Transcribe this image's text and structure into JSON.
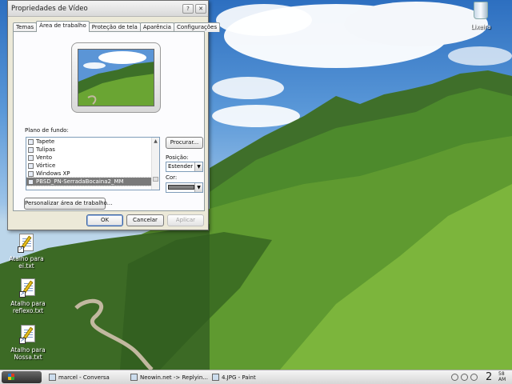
{
  "dialog": {
    "title": "Propriedades de Vídeo",
    "tabs": [
      "Temas",
      "Área de trabalho",
      "Proteção de tela",
      "Aparência",
      "Configurações"
    ],
    "active_tab": 1,
    "background_label": "Plano de fundo:",
    "background_items": [
      "Tapete",
      "Tulipas",
      "Vento",
      "Vórtice",
      "Windows XP",
      "PBSD_PN-SerradaBocaina2_MM"
    ],
    "selected_item": 5,
    "browse_button": "Procurar...",
    "position_label": "Posição:",
    "position_value": "Estender",
    "color_label": "Cor:",
    "customize_button": "Personalizar área de trabalho...",
    "ok_button": "OK",
    "cancel_button": "Cancelar",
    "apply_button": "Aplicar"
  },
  "desktop": {
    "icons": [
      {
        "label": "Lixeira"
      },
      {
        "label": "Atalho para ei.txt"
      },
      {
        "label": "Atalho para reflexo.txt"
      },
      {
        "label": "Atalho para Nossa.txt"
      }
    ]
  },
  "taskbar": {
    "tasks": [
      "marcel - Conversa",
      "Neowin.net -> Replyin...",
      "4.JPG - Paint"
    ],
    "clock_hour": "2",
    "clock_minute": "58",
    "clock_ampm": "AM"
  },
  "colors": {
    "dialog_bg": "#ece9d8",
    "selection": "#7a7a7a",
    "accent": "#355fa0"
  }
}
